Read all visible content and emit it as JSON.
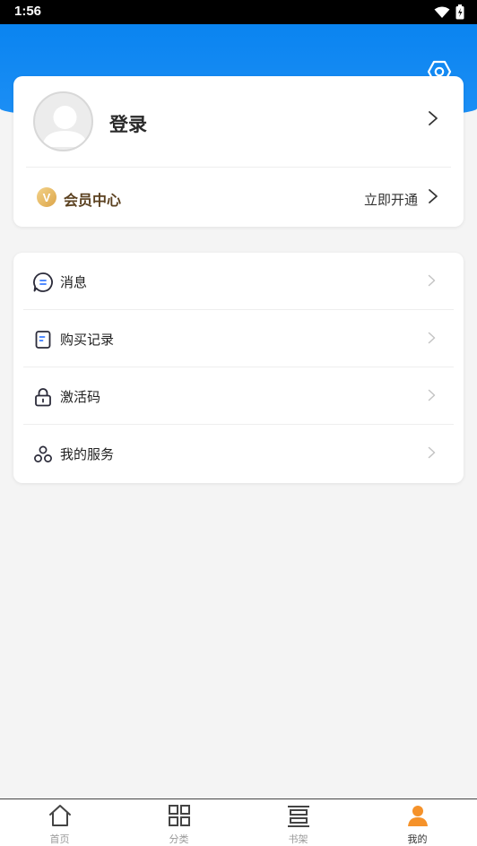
{
  "status_bar": {
    "time": "1:56"
  },
  "profile": {
    "login_label": "登录"
  },
  "vip": {
    "badge": "V",
    "label": "会员中心",
    "action": "立即开通"
  },
  "menu": {
    "items": [
      {
        "label": "消息",
        "icon": "message-icon"
      },
      {
        "label": "购买记录",
        "icon": "purchase-record-icon"
      },
      {
        "label": "激活码",
        "icon": "lock-icon"
      },
      {
        "label": "我的服务",
        "icon": "services-icon"
      }
    ]
  },
  "tabs": [
    {
      "label": "首页",
      "icon": "home-icon"
    },
    {
      "label": "分类",
      "icon": "category-grid-icon"
    },
    {
      "label": "书架",
      "icon": "bookshelf-icon"
    },
    {
      "label": "我的",
      "icon": "person-icon",
      "active": true
    }
  ],
  "colors": {
    "header_blue": "#0a84f0",
    "tab_active": "#f5922a",
    "vip_gold": "#dca548"
  }
}
